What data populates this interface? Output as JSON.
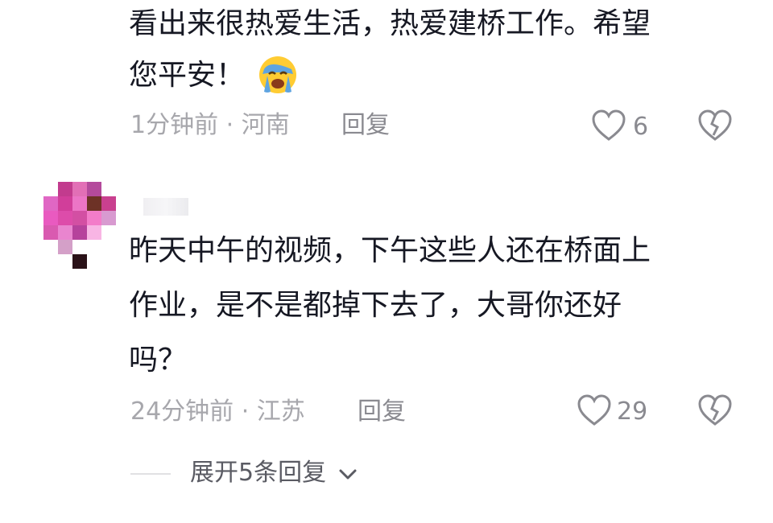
{
  "comment1": {
    "line1": "看出来很热爱生活，热爱建桥工作。希望",
    "line2": "您平安！",
    "time": "1分钟前",
    "location": "河南",
    "reply_label": "回复",
    "likes": "6"
  },
  "comment2": {
    "line1": "昨天中午的视频，下午这些人还在桥面上",
    "line2": "作业，是不是都掉下去了，大哥你还好",
    "line3": "吗？",
    "time": "24分钟前",
    "location": "江苏",
    "reply_label": "回复",
    "likes": "29"
  },
  "expand_replies": "展开5条回复",
  "colors": {
    "text": "#161823",
    "meta": "#a7a7ac",
    "icon": "#8a8a90"
  }
}
